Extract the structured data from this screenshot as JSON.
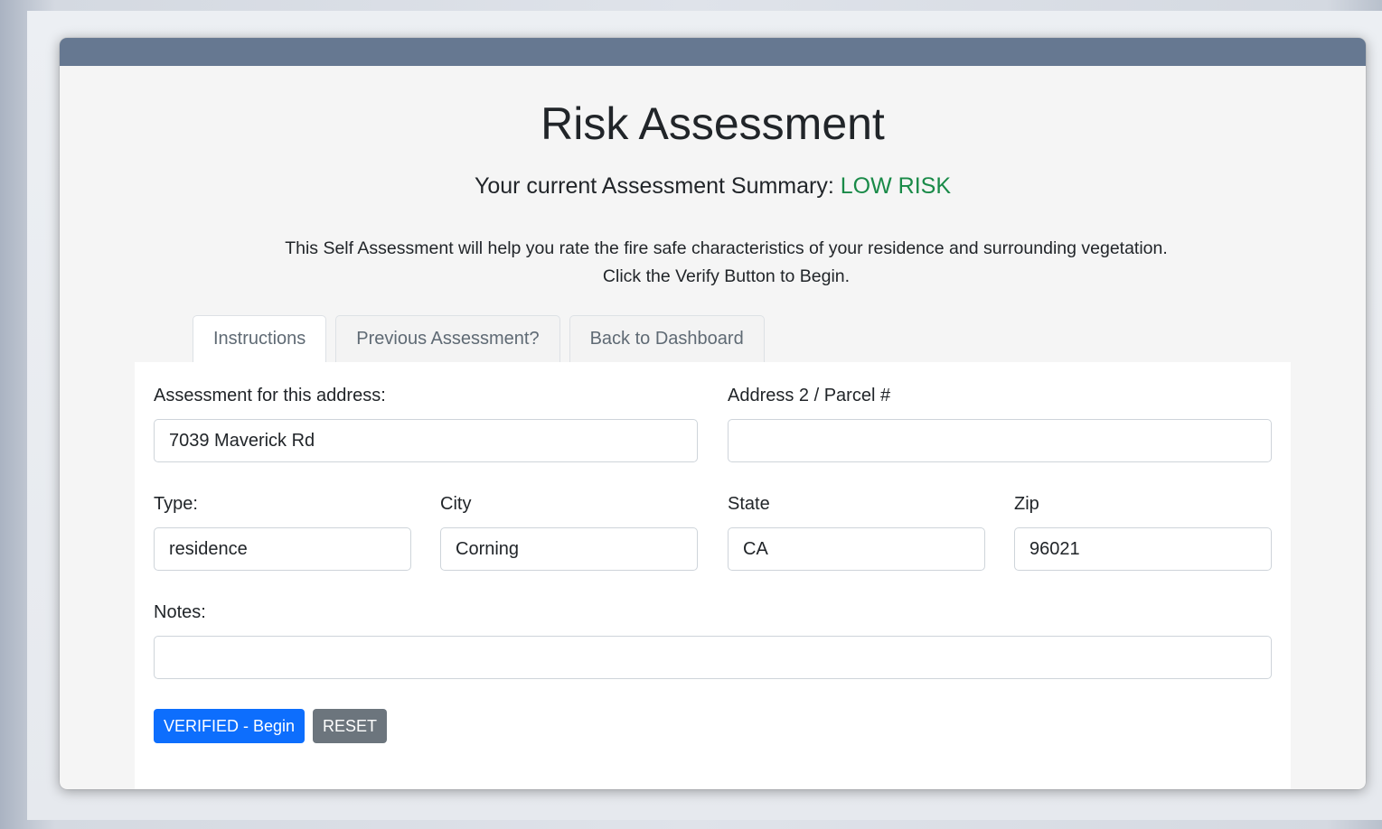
{
  "page": {
    "title": "Risk Assessment",
    "summary_label": "Your current Assessment Summary:",
    "summary_value": "LOW RISK",
    "description_line1": "This Self Assessment will help you rate the fire safe characteristics of your residence and surrounding vegetation.",
    "description_line2": "Click the Verify Button to Begin."
  },
  "tabs": [
    {
      "label": "Instructions",
      "active": true
    },
    {
      "label": "Previous Assessment?",
      "active": false
    },
    {
      "label": "Back to Dashboard",
      "active": false
    }
  ],
  "form": {
    "address_label": "Assessment for this address:",
    "address_value": "7039 Maverick Rd",
    "address2_label": "Address 2 / Parcel #",
    "address2_value": "",
    "type_label": "Type:",
    "type_value": "residence",
    "city_label": "City",
    "city_value": "Corning",
    "state_label": "State",
    "state_value": "CA",
    "zip_label": "Zip",
    "zip_value": "96021",
    "notes_label": "Notes:",
    "notes_value": ""
  },
  "buttons": {
    "verify_label": "VERIFIED - Begin",
    "reset_label": "RESET"
  },
  "colors": {
    "titlebar": "#667891",
    "risk_low": "#198a48",
    "primary": "#0d6efd",
    "secondary": "#6c757d"
  }
}
